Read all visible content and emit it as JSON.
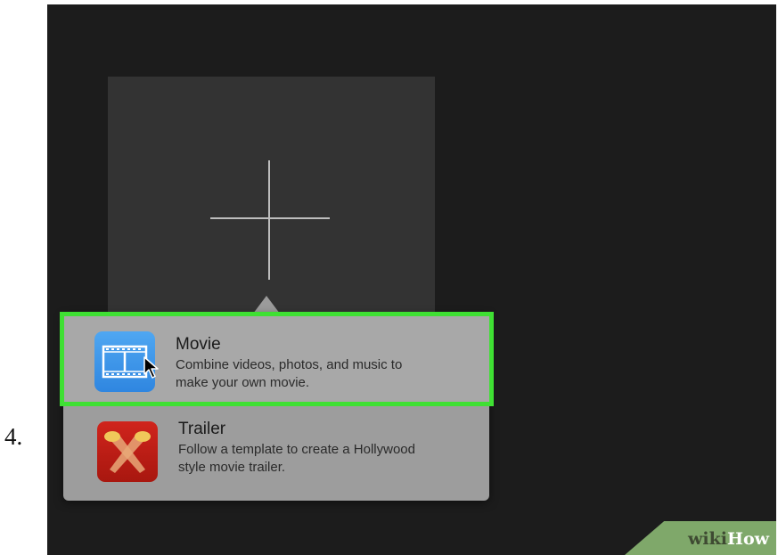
{
  "step": {
    "number_label": "4."
  },
  "new_project": {
    "icon": "plus-icon"
  },
  "popover": {
    "options": [
      {
        "title": "Movie",
        "description_line1": "Combine videos, photos, and music to",
        "description_line2": "make your own movie.",
        "icon": "film-strip-icon",
        "icon_color": "#3d97ea",
        "highlighted": true,
        "highlight_color": "#3fe033"
      },
      {
        "title": "Trailer",
        "description_line1": "Follow a template to create a Hollywood",
        "description_line2": "style movie trailer.",
        "icon": "spotlights-icon",
        "icon_color": "#c01e16",
        "highlighted": false
      }
    ]
  },
  "watermark": {
    "wiki": "wiki",
    "how": "How",
    "color": "#7fa86a"
  }
}
